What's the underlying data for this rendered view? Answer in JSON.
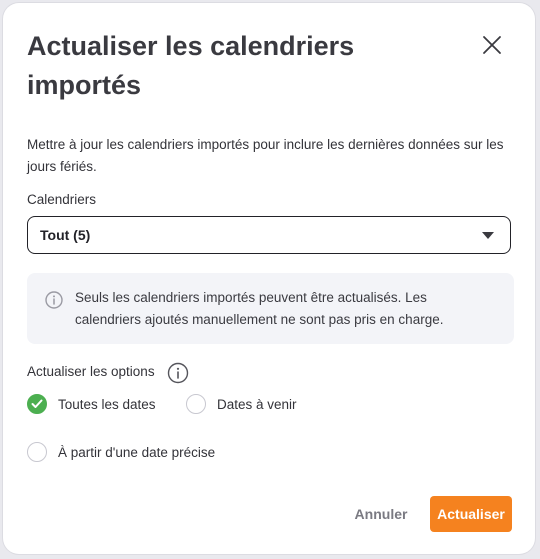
{
  "dialog": {
    "title": "Actualiser les calendriers importés",
    "description": "Mettre à jour les calendriers importés pour inclure les dernières données sur les jours fériés.",
    "close_icon": "close-icon"
  },
  "calendars": {
    "label": "Calendriers",
    "selected_value": "Tout (5)",
    "caret_icon": "caret-down-icon"
  },
  "notice": {
    "icon": "info-icon",
    "text": "Seuls les calendriers importés peuvent être actualisés. Les calendriers ajoutés manuellement ne sont pas pris en charge."
  },
  "options": {
    "label": "Actualiser les options",
    "info_icon": "info-icon",
    "items": [
      {
        "label": "Toutes les dates",
        "checked": true
      },
      {
        "label": "Dates à venir",
        "checked": false
      },
      {
        "label": "À partir d'une date précise",
        "checked": false
      }
    ]
  },
  "footer": {
    "cancel_label": "Annuler",
    "submit_label": "Actualiser"
  },
  "colors": {
    "accent": "#f5821f",
    "checked": "#4caf50",
    "notice_bg": "#f3f4f8"
  }
}
